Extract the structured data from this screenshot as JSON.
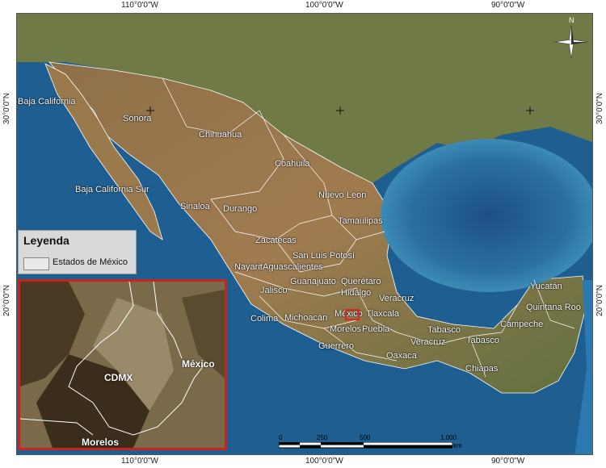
{
  "graticule": {
    "top": [
      "110°0'0\"W",
      "100°0'0\"W",
      "90°0'0\"W"
    ],
    "bottom": [
      "110°0'0\"W",
      "100°0'0\"W",
      "90°0'0\"W"
    ],
    "left": [
      "30°0'0\"N",
      "20°0'0\"N"
    ],
    "right": [
      "30°0'0\"N",
      "20°0'0\"N"
    ]
  },
  "states": [
    "Baja California",
    "Sonora",
    "Chihuahua",
    "Coahuila",
    "Baja California Sur",
    "Nuevo Leon",
    "Sinaloa",
    "Durango",
    "Tamaulipas",
    "Zacatecas",
    "San Luis Potosí",
    "Nayarit",
    "Aguascalientes",
    "Guanajuato",
    "Querétaro",
    "Jalisco",
    "Hidalgo",
    "Veracruz",
    "México",
    "Tlaxcala",
    "Colima",
    "Michoacán",
    "Morelos",
    "Puebla",
    "Guerrero",
    "Oaxaca",
    "Yucatán",
    "Quintana Roo",
    "Campeche",
    "Tabasco",
    "Veracruz",
    "Tabasco",
    "Chiapas"
  ],
  "legend": {
    "title": "Leyenda",
    "item": "Estados de México"
  },
  "inset": {
    "labels": [
      "CDMX",
      "México",
      "Morelos"
    ]
  },
  "scale": {
    "ticks": [
      "0",
      "250",
      "500",
      "1,000"
    ],
    "unit": "km"
  },
  "north": "N",
  "colors": {
    "ocean": "#1f5a8a",
    "land": "#8a6a3f",
    "inset_border": "#c9231e"
  }
}
